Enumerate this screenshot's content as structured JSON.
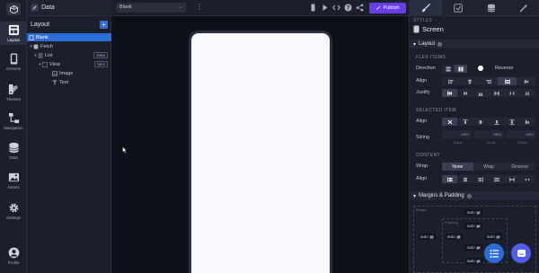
{
  "app": {
    "name": "Data"
  },
  "rail": {
    "items": [
      {
        "key": "layout",
        "label": "Layout",
        "icon": "layout-icon",
        "active": true
      },
      {
        "key": "screens",
        "label": "Screens",
        "icon": "screens-icon"
      },
      {
        "key": "themes",
        "label": "Themes",
        "icon": "themes-icon"
      },
      {
        "key": "navigation",
        "label": "Navigation",
        "icon": "navigation-icon"
      },
      {
        "key": "data",
        "label": "Data",
        "icon": "database-icon"
      },
      {
        "key": "assets",
        "label": "Assets",
        "icon": "assets-icon"
      },
      {
        "key": "settings",
        "label": "Settings",
        "icon": "gear-icon"
      },
      {
        "key": "profile",
        "label": "Profile",
        "icon": "profile-icon"
      }
    ]
  },
  "layout_panel": {
    "title": "Layout",
    "add_label": "+",
    "tree": [
      {
        "label": "Blank",
        "icon": "screen-icon",
        "selected": true
      },
      {
        "label": "Fetch",
        "icon": "fetch-icon",
        "chevron": "▾"
      },
      {
        "label": "List",
        "icon": "list-icon",
        "chevron": "▾",
        "badge": "Data"
      },
      {
        "label": "View",
        "icon": "view-icon",
        "chevron": "▾",
        "badge": "Item"
      },
      {
        "label": "Image",
        "icon": "image-icon"
      },
      {
        "label": "Text",
        "icon": "text-icon"
      }
    ]
  },
  "toolbar": {
    "device": "Blank",
    "device_caret": "⌄",
    "kebab": "⋮",
    "icons": [
      "mobile-icon",
      "play-icon",
      "code-icon",
      "help-icon",
      "share-icon"
    ],
    "publish_label": "Publish"
  },
  "styles_panel": {
    "tabs": [
      "paintbrush-icon",
      "config-icon",
      "database-icon",
      "wand-icon"
    ],
    "styles_label": "STYLES",
    "screen_label": "Screen",
    "layout_section": {
      "title": "Layout",
      "flex_items_label": "FLEX ITEMS",
      "direction_label": "Direction",
      "reverse_label": "Reverse",
      "align_label": "Align",
      "justify_label": "Justify",
      "selected_item_label": "SELECTED ITEM",
      "sizing_label": "Sizing",
      "sizing_values": [
        "auto",
        "auto",
        "auto"
      ],
      "sizing_captions": [
        "Basis",
        "Grow",
        "Shrink"
      ],
      "content_label": "CONTENT",
      "wrap_label": "Wrap",
      "wrap_options": [
        "None",
        "Wrap",
        "Reverse"
      ],
      "wrap_selected": "None"
    },
    "margins_section": {
      "title": "Margins & Padding",
      "margin_caption": "Margin",
      "padding_caption": "Padding",
      "value": "auto",
      "unit": "pt"
    }
  },
  "colors": {
    "accent": "#2c6dd8",
    "publish": "#6a3df0",
    "fab_list": "#2c6dd8",
    "fab_chat": "#4f5df2"
  }
}
